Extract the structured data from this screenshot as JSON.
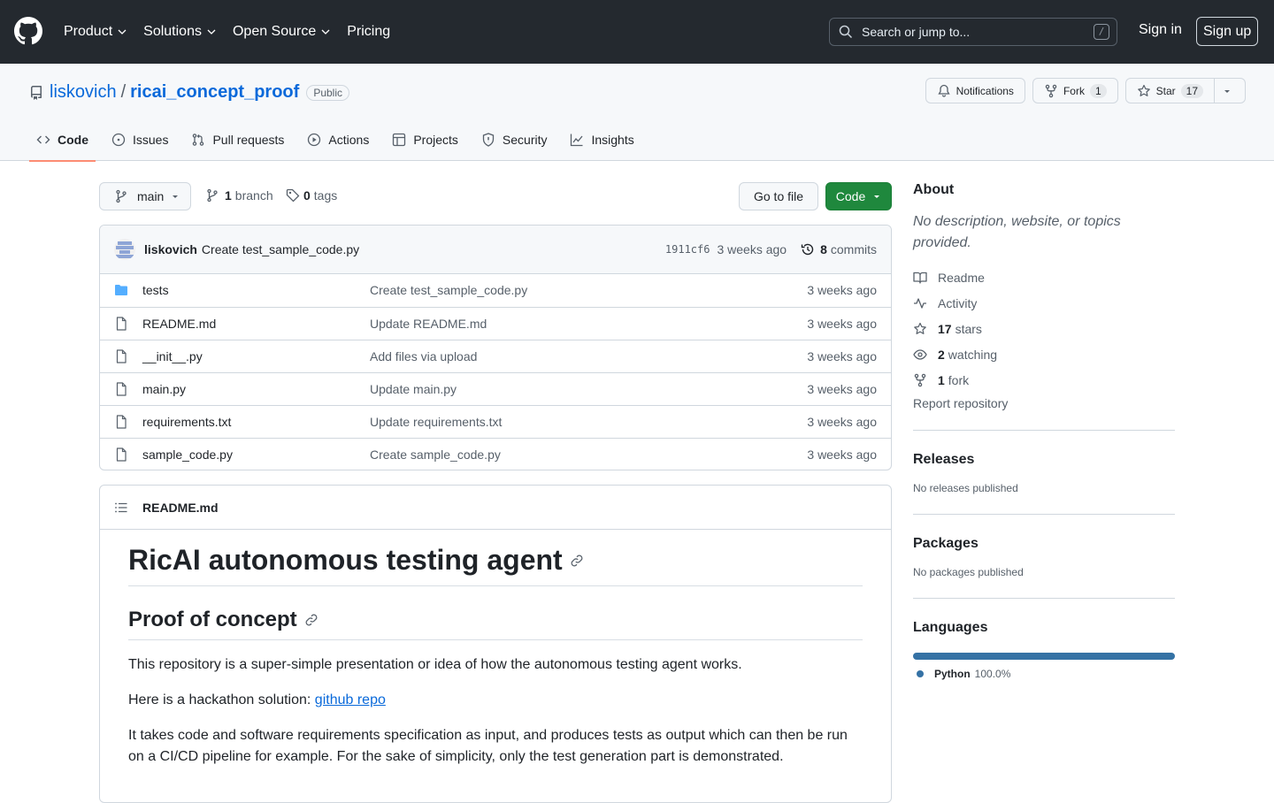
{
  "header": {
    "nav": [
      {
        "label": "Product",
        "has_menu": true
      },
      {
        "label": "Solutions",
        "has_menu": true
      },
      {
        "label": "Open Source",
        "has_menu": true
      },
      {
        "label": "Pricing",
        "has_menu": false
      }
    ],
    "search_placeholder": "Search or jump to...",
    "search_shortcut": "/",
    "sign_in": "Sign in",
    "sign_up": "Sign up"
  },
  "repo": {
    "owner": "liskovich",
    "separator": "/",
    "name": "ricai_concept_proof",
    "visibility": "Public",
    "actions": {
      "notifications": "Notifications",
      "fork_label": "Fork",
      "fork_count": "1",
      "star_label": "Star",
      "star_count": "17"
    },
    "tabs": [
      {
        "label": "Code",
        "icon": "code-icon",
        "active": true
      },
      {
        "label": "Issues",
        "icon": "issue-icon"
      },
      {
        "label": "Pull requests",
        "icon": "pull-request-icon"
      },
      {
        "label": "Actions",
        "icon": "play-icon"
      },
      {
        "label": "Projects",
        "icon": "table-icon"
      },
      {
        "label": "Security",
        "icon": "shield-icon"
      },
      {
        "label": "Insights",
        "icon": "graph-icon"
      }
    ]
  },
  "toolbar": {
    "branch": "main",
    "branch_count": "1",
    "branch_word": "branch",
    "tag_count": "0",
    "tag_word": "tags",
    "go_to_file": "Go to file",
    "code": "Code"
  },
  "last_commit": {
    "author": "liskovich",
    "message": "Create test_sample_code.py",
    "sha": "1911cf6",
    "age": "3 weeks ago",
    "commit_count": "8",
    "commit_word": "commits"
  },
  "files": [
    {
      "type": "dir",
      "name": "tests",
      "message": "Create test_sample_code.py",
      "age": "3 weeks ago"
    },
    {
      "type": "file",
      "name": "README.md",
      "message": "Update README.md",
      "age": "3 weeks ago"
    },
    {
      "type": "file",
      "name": "__init__.py",
      "message": "Add files via upload",
      "age": "3 weeks ago"
    },
    {
      "type": "file",
      "name": "main.py",
      "message": "Update main.py",
      "age": "3 weeks ago"
    },
    {
      "type": "file",
      "name": "requirements.txt",
      "message": "Update requirements.txt",
      "age": "3 weeks ago"
    },
    {
      "type": "file",
      "name": "sample_code.py",
      "message": "Create sample_code.py",
      "age": "3 weeks ago"
    }
  ],
  "readme": {
    "filename": "README.md",
    "h1": "RicAI autonomous testing agent",
    "h2": "Proof of concept",
    "p1": "This repository is a super-simple presentation or idea of how the autonomous testing agent works.",
    "p2_prefix": "Here is a hackathon solution: ",
    "p2_link": "github repo",
    "p3": "It takes code and software requirements specification as input, and produces tests as output which can then be run on a CI/CD pipeline for example. For the sake of simplicity, only the test generation part is demonstrated."
  },
  "sidebar": {
    "about_title": "About",
    "about_desc": "No description, website, or topics provided.",
    "items": {
      "readme": "Readme",
      "activity": "Activity",
      "stars_count": "17",
      "stars_word": "stars",
      "watching_count": "2",
      "watching_word": "watching",
      "fork_count": "1",
      "fork_word": "fork"
    },
    "report": "Report repository",
    "releases_title": "Releases",
    "releases_text": "No releases published",
    "packages_title": "Packages",
    "packages_text": "No packages published",
    "languages_title": "Languages",
    "language_name": "Python",
    "language_pct": "100.0%",
    "language_fraction": 1.0,
    "language_color": "#3572a5"
  },
  "colors": {
    "header_bg": "#24292f",
    "link": "#0969da",
    "primary_button": "#1f883d",
    "active_tab_underline": "#fd8c73"
  }
}
